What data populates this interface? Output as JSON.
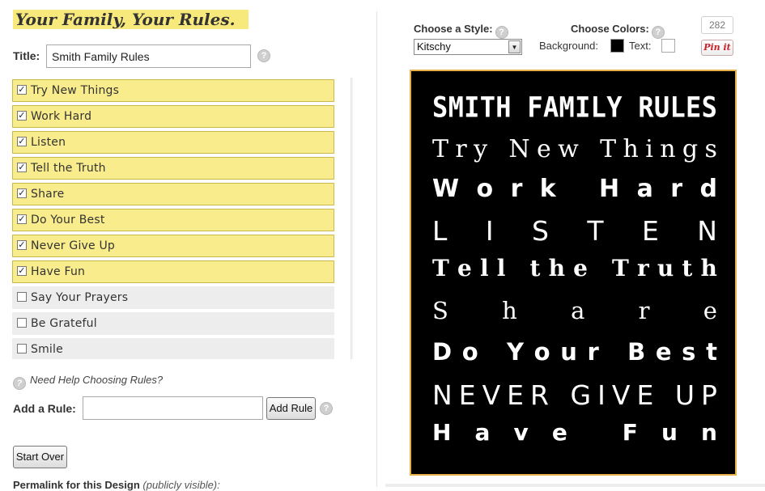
{
  "heading": "Your Family, Your Rules.",
  "title_field": {
    "label": "Title:",
    "value": "Smith Family Rules",
    "help": "?"
  },
  "rules": [
    {
      "label": "Try New Things",
      "checked": true
    },
    {
      "label": "Work Hard",
      "checked": true
    },
    {
      "label": "Listen",
      "checked": true
    },
    {
      "label": "Tell the Truth",
      "checked": true
    },
    {
      "label": "Share",
      "checked": true
    },
    {
      "label": "Do Your Best",
      "checked": true
    },
    {
      "label": "Never Give Up",
      "checked": true
    },
    {
      "label": "Have Fun",
      "checked": true
    },
    {
      "label": "Say Your Prayers",
      "checked": false
    },
    {
      "label": "Be Grateful",
      "checked": false
    },
    {
      "label": "Smile",
      "checked": false
    }
  ],
  "checkmark": "✓",
  "scroll_up": "▲",
  "scroll_down": "▼",
  "scroll_grip": "≡",
  "need_help": "Need Help Choosing Rules?",
  "add_rule": {
    "label": "Add a Rule:",
    "value": "",
    "button": "Add Rule"
  },
  "start_over": "Start Over",
  "permalink": {
    "label": "Permalink for this Design",
    "note": "(publicly visible):"
  },
  "style": {
    "label": "Choose a Style:",
    "selected": "Kitschy",
    "arrow": "▼"
  },
  "colors": {
    "label": "Choose Colors:",
    "background_label": "Background:",
    "background": "#000000",
    "text_label": "Text:",
    "text": "#ffffff"
  },
  "pinit": {
    "count": "282",
    "label": "Pin it"
  },
  "poster": {
    "title": "SMITH FAMILY RULES",
    "lines": [
      "Try New Things",
      "Work Hard",
      "LISTEN",
      "Tell the Truth",
      "Share",
      "Do Your Best",
      "NEVER GIVE UP",
      "Have Fun"
    ],
    "border_color": "#e8b04a"
  }
}
